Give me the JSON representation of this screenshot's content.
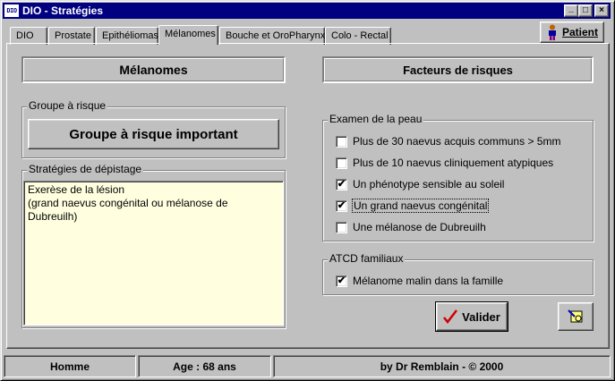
{
  "window": {
    "app_icon_text": "DIO",
    "title": "DIO - Stratégies",
    "minimize_glyph": "_",
    "maximize_glyph": "□",
    "close_glyph": "×"
  },
  "tabs": [
    {
      "label": "DIO"
    },
    {
      "label": "Prostate"
    },
    {
      "label": "Epithéliomas"
    },
    {
      "label": "Mélanomes"
    },
    {
      "label": "Bouche et OroPharynx"
    },
    {
      "label": "Colo - Rectal"
    }
  ],
  "active_tab": "Mélanomes",
  "patient_button": {
    "label": "Patient",
    "icon": "person-icon"
  },
  "left": {
    "header": "Mélanomes",
    "risk_group": {
      "legend": "Groupe à risque",
      "value": "Groupe à risque important"
    },
    "strategy": {
      "legend": "Stratégies de dépistage",
      "text": "Exerèse de la lésion\n(grand naevus congénital ou mélanose de\nDubreuilh)"
    }
  },
  "right": {
    "header": "Facteurs de risques",
    "skin_exam": {
      "legend": "Examen de la peau",
      "items": [
        {
          "label": "Plus de 30 naevus acquis communs > 5mm",
          "checked": false,
          "mark": ""
        },
        {
          "label": "Plus de 10 naevus cliniquement atypiques",
          "checked": false,
          "mark": ""
        },
        {
          "label": "Un phénotype sensible au soleil",
          "checked": true,
          "mark": "✔"
        },
        {
          "label": "Un grand naevus congénital",
          "checked": true,
          "mark": "✔"
        },
        {
          "label": "Une mélanose de Dubreuilh",
          "checked": false,
          "mark": ""
        }
      ]
    },
    "family_history": {
      "legend": "ATCD familiaux",
      "items": [
        {
          "label": "Mélanome malin dans la famille",
          "checked": true,
          "mark": "✔"
        }
      ]
    }
  },
  "buttons": {
    "validate_label": "Valider",
    "validate_icon": "red-checkmark-icon",
    "tool_icon": "edit-tool-icon"
  },
  "statusbar": {
    "sex": "Homme",
    "age": "Age : 68 ans",
    "credit": "by Dr Remblain - © 2000"
  }
}
